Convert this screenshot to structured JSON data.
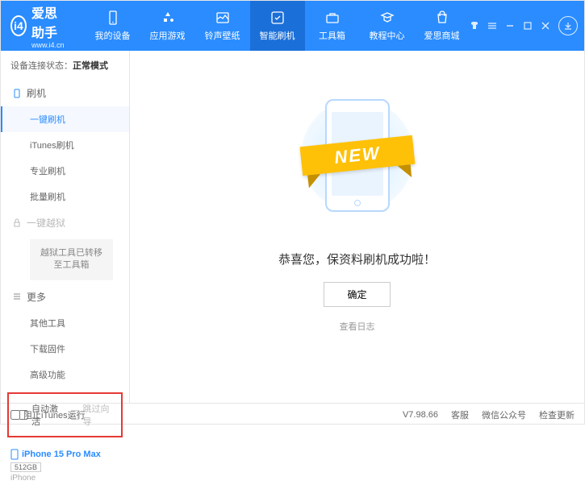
{
  "app": {
    "name": "爱思助手",
    "url": "www.i4.cn"
  },
  "nav": [
    {
      "label": "我的设备"
    },
    {
      "label": "应用游戏"
    },
    {
      "label": "铃声壁纸"
    },
    {
      "label": "智能刷机"
    },
    {
      "label": "工具箱"
    },
    {
      "label": "教程中心"
    },
    {
      "label": "爱思商城"
    }
  ],
  "conn": {
    "prefix": "设备连接状态：",
    "status": "正常模式"
  },
  "sidebar": {
    "flash": {
      "title": "刷机",
      "items": [
        "一键刷机",
        "iTunes刷机",
        "专业刷机",
        "批量刷机"
      ]
    },
    "jailbreak": {
      "title": "一键越狱",
      "moved": "越狱工具已转移至工具箱"
    },
    "more": {
      "title": "更多",
      "items": [
        "其他工具",
        "下载固件",
        "高级功能"
      ]
    }
  },
  "checks": {
    "auto_activate": "自动激活",
    "skip_guide": "跳过向导"
  },
  "device": {
    "name": "iPhone 15 Pro Max",
    "storage": "512GB",
    "type": "iPhone"
  },
  "main": {
    "badge": "NEW",
    "success": "恭喜您，保资料刷机成功啦！",
    "ok": "确定",
    "log": "查看日志"
  },
  "footer": {
    "block_itunes": "阻止iTunes运行",
    "version": "V7.98.66",
    "support": "客服",
    "wechat": "微信公众号",
    "update": "检查更新"
  }
}
